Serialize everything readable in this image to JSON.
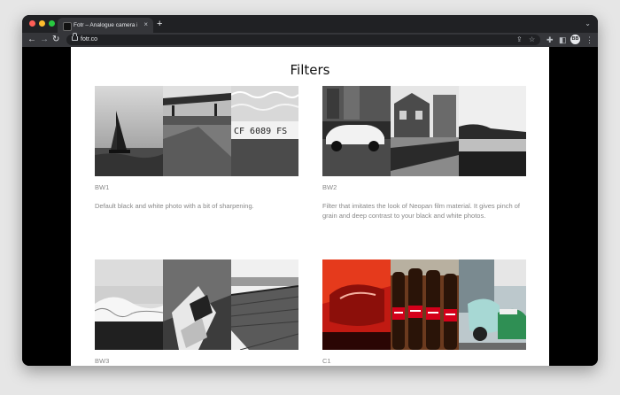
{
  "browser": {
    "tab_title": "Fotr – Analogue camera in you",
    "tab_close": "×",
    "new_tab": "+",
    "url": "fotr.co",
    "avatar_initials": "BB"
  },
  "icons": {
    "back": "back-arrow-icon",
    "forward": "forward-arrow-icon",
    "reload": "reload-icon",
    "lock": "lock-icon",
    "share": "share-icon",
    "bookmark": "star-icon",
    "extensions": "puzzle-icon",
    "side_panel": "side-panel-icon",
    "menu": "kebab-menu-icon",
    "tab_menu": "chevron-down-icon"
  },
  "page": {
    "title": "Filters",
    "filters": [
      {
        "name": "BW1",
        "description": "Default black and white photo with a bit of sharpening.",
        "photos": [
          "sailboat at sea",
          "gas station",
          "license plate CF 6089 FS"
        ]
      },
      {
        "name": "BW2",
        "description": "Filter that imitates the look of Neopan film material. It gives pinch of grain and deep contrast to your black and white photos.",
        "photos": [
          "vintage car",
          "street with houses",
          "beach and sea"
        ]
      },
      {
        "name": "BW3",
        "description": "",
        "photos": [
          "coastline",
          "modern building",
          "wooden pier"
        ]
      },
      {
        "name": "C1",
        "description": "",
        "photos": [
          "red car",
          "coca-cola bottles",
          "scooters"
        ]
      }
    ]
  },
  "colors": {
    "tabbar": "#202124",
    "toolbar": "#35363a",
    "page_bg": "#ffffff",
    "caption": "#888888"
  }
}
